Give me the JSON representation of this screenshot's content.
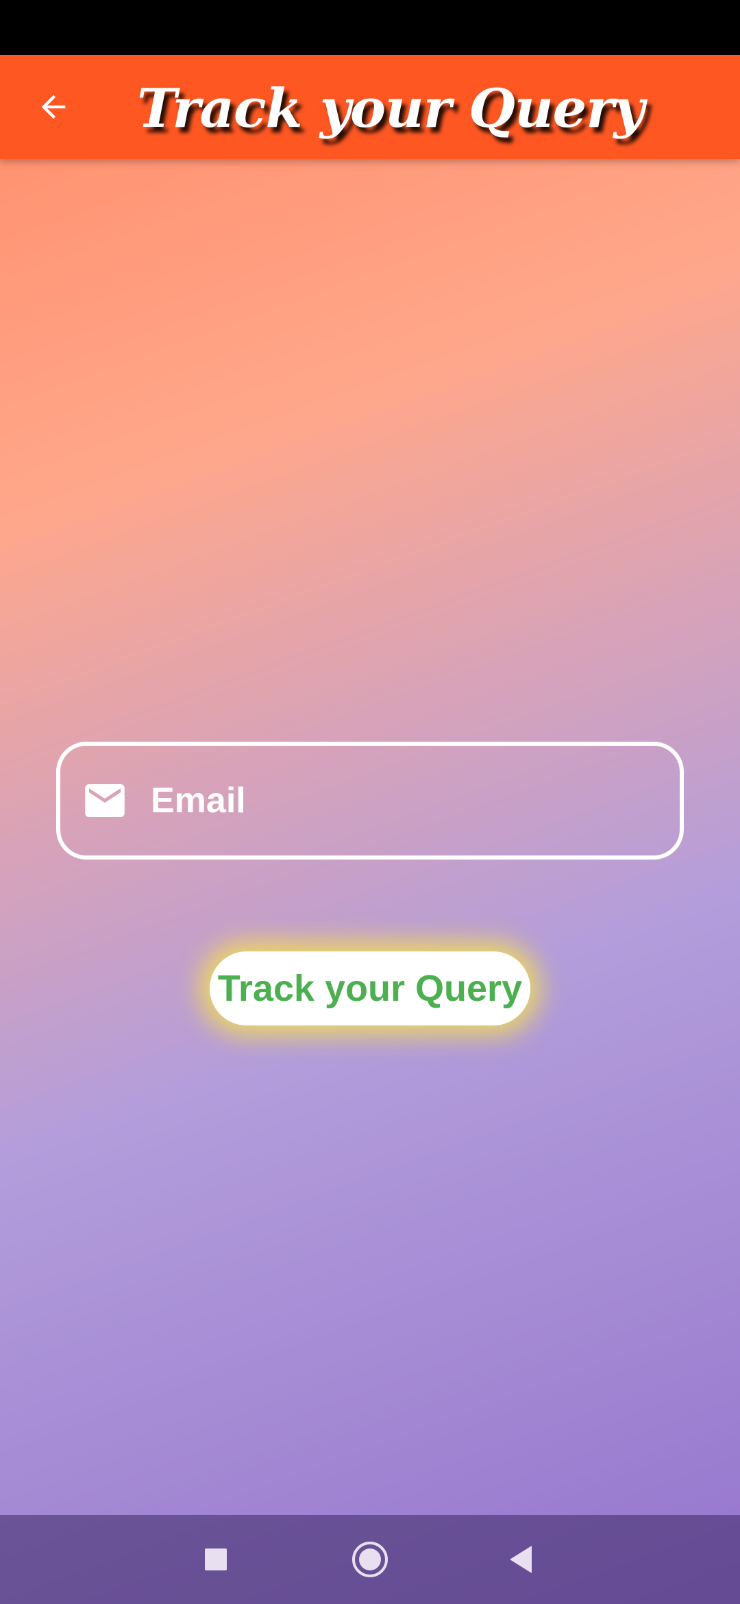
{
  "app_bar": {
    "title": "Track your Query",
    "back_icon": "arrow-back-icon",
    "color": "#ff5722"
  },
  "form": {
    "email": {
      "icon": "mail-icon",
      "placeholder": "Email",
      "value": ""
    },
    "submit_label": "Track your Query",
    "submit_text_color": "#4caf50",
    "submit_glow_color": "#ffeb3b"
  },
  "nav_bar": {
    "recents_icon": "square-icon",
    "home_icon": "circle-icon",
    "back_icon": "triangle-back-icon"
  }
}
